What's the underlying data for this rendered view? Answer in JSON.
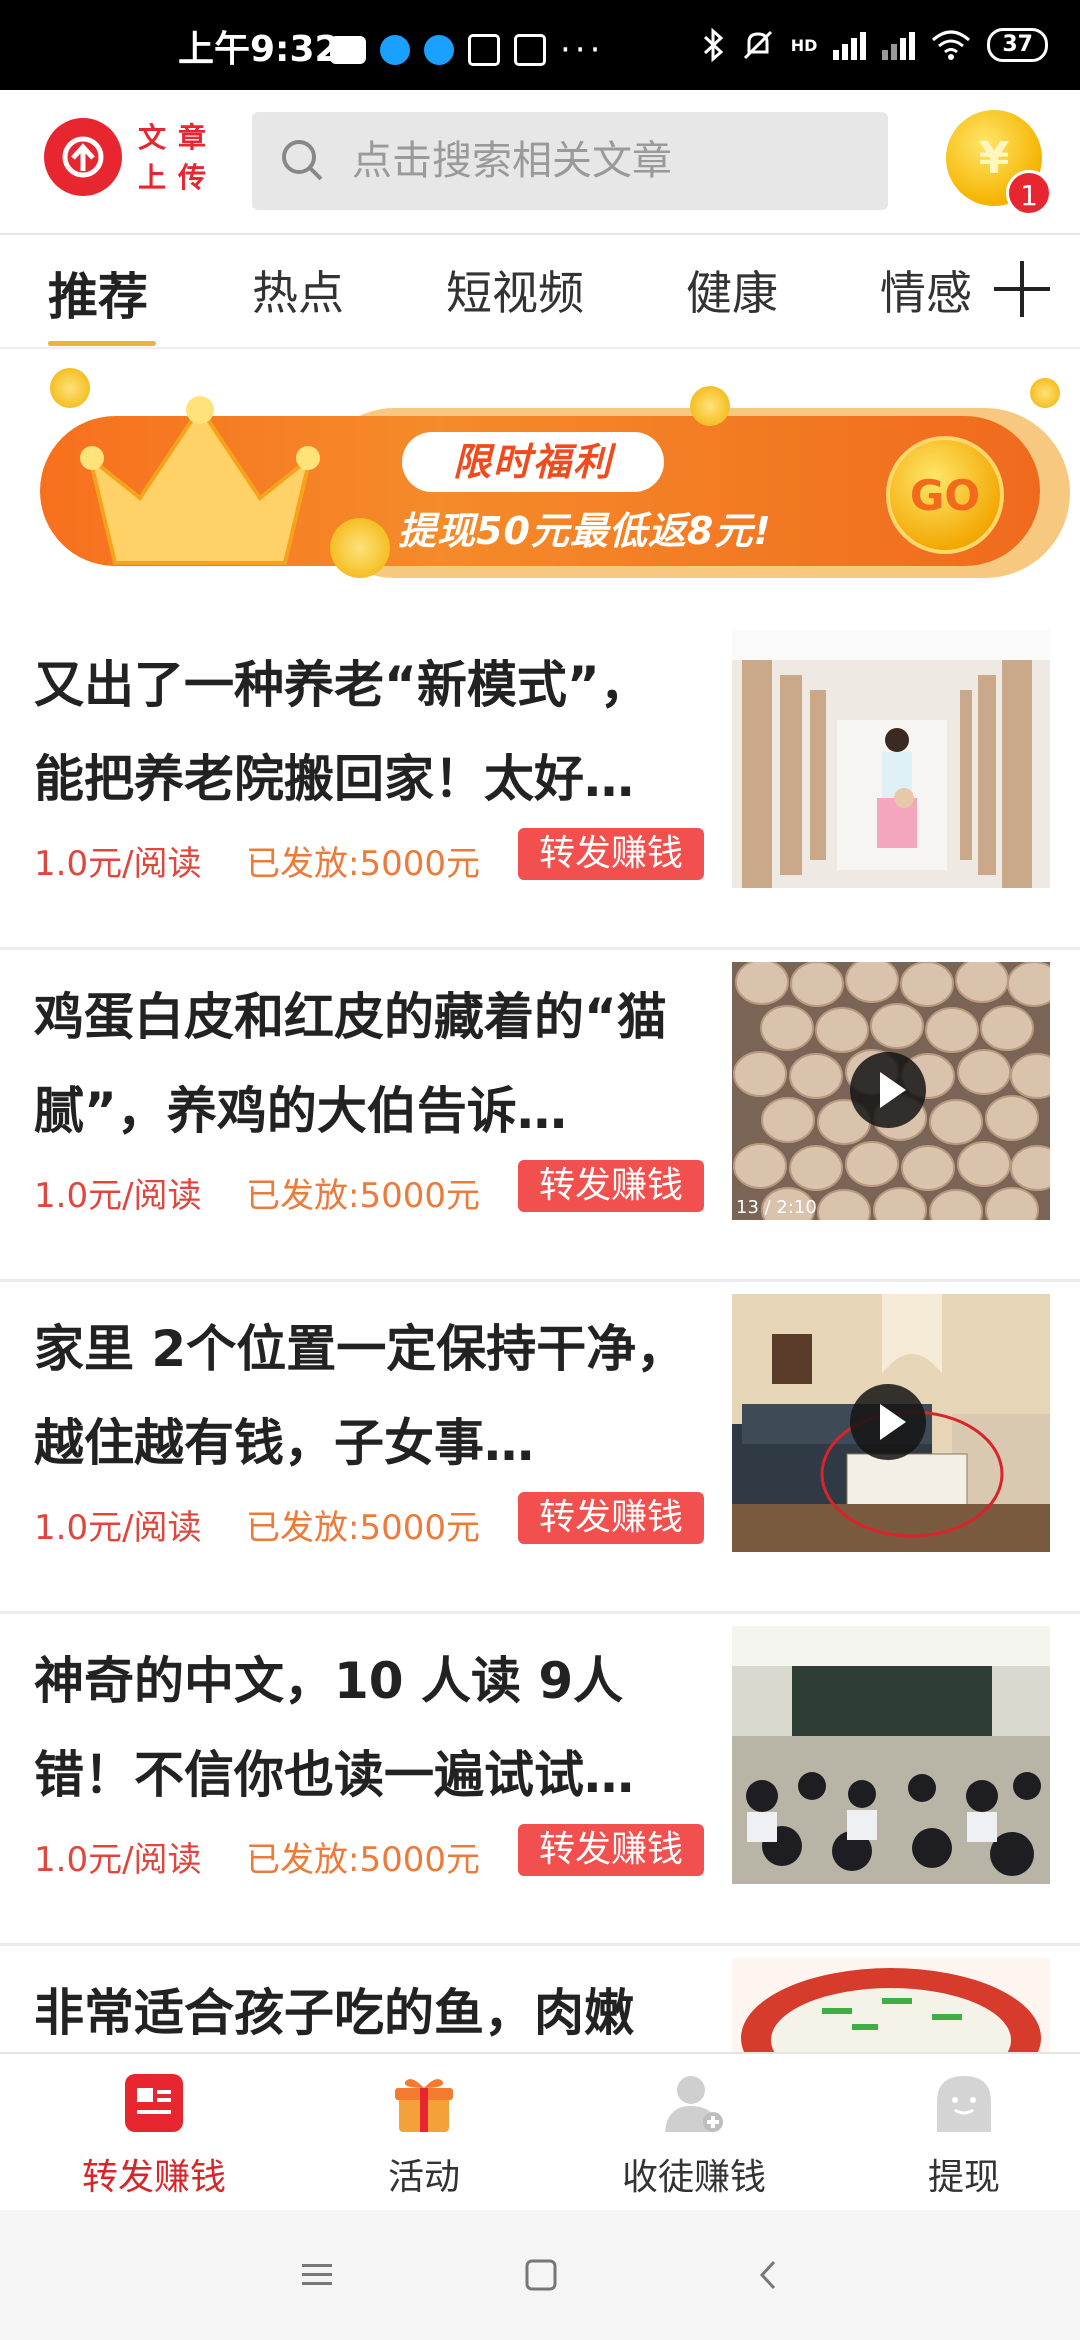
{
  "status_bar": {
    "time": "上午9:32",
    "network": "HD",
    "battery": "37"
  },
  "header": {
    "logo_text": "文章上传",
    "search_placeholder": "点击搜索相关文章",
    "coin_symbol": "¥",
    "coin_badge": "1"
  },
  "tabs": [
    {
      "label": "推荐",
      "active": true
    },
    {
      "label": "热点",
      "active": false
    },
    {
      "label": "短视频",
      "active": false
    },
    {
      "label": "健康",
      "active": false
    },
    {
      "label": "情感",
      "active": false
    }
  ],
  "banner": {
    "tag": "限时福利",
    "text": "提现50元最低返8元!",
    "go": "GO"
  },
  "articles": [
    {
      "title": "又出了一种养老“新模式”，能把养老院搬回家！太好…",
      "price": "1.0元/阅读",
      "issued": "已发放:5000元",
      "action": "转发赚钱",
      "has_video": false,
      "duration": ""
    },
    {
      "title": "鸡蛋白皮和红皮的藏着的“猫腻”，养鸡的大伯告诉…",
      "price": "1.0元/阅读",
      "issued": "已发放:5000元",
      "action": "转发赚钱",
      "has_video": true,
      "duration": "13 / 2:10"
    },
    {
      "title": "家里 2个位置一定保持干净，越住越有钱，子女事…",
      "price": "1.0元/阅读",
      "issued": "已发放:5000元",
      "action": "转发赚钱",
      "has_video": true,
      "duration": ""
    },
    {
      "title": "神奇的中文，10 人读 9人错！不信你也读一遍试试…",
      "price": "1.0元/阅读",
      "issued": "已发放:5000元",
      "action": "转发赚钱",
      "has_video": false,
      "duration": ""
    },
    {
      "title": "非常适合孩子吃的鱼，肉嫩",
      "price": "",
      "issued": "",
      "action": "",
      "has_video": false,
      "duration": ""
    }
  ],
  "bottom_nav": [
    {
      "label": "转发赚钱",
      "icon": "news-icon",
      "active": true
    },
    {
      "label": "活动",
      "icon": "gift-icon",
      "active": false
    },
    {
      "label": "收徒赚钱",
      "icon": "add-user-icon",
      "active": false
    },
    {
      "label": "提现",
      "icon": "withdraw-icon",
      "active": false
    }
  ],
  "colors": {
    "accent_red": "#e8262f",
    "orange": "#f7701e",
    "tab_underline": "#f0b13c"
  }
}
